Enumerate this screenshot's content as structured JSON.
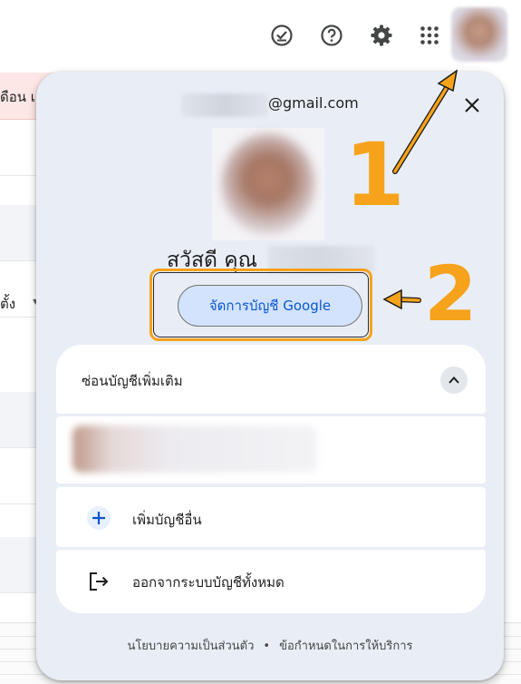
{
  "background": {
    "alert_text": "ดือน เ",
    "row_text": "ตั้ง"
  },
  "toolbar": {
    "icons": [
      "tasks-check-icon",
      "help-icon",
      "settings-gear-icon",
      "apps-grid-icon"
    ]
  },
  "panel": {
    "email": "@gmail.com",
    "greeting": "สวัสดี คุณ",
    "manage_button": "จัดการบัญชี Google",
    "hide_accounts_label": "ซ่อนบัญชีเพิ่มเติม",
    "add_account_label": "เพิ่มบัญชีอื่น",
    "sign_out_label": "ออกจากระบบบัญชีทั้งหมด",
    "footer": {
      "privacy": "นโยบายความเป็นส่วนตัว",
      "separator": "•",
      "terms": "ข้อกำหนดในการให้บริการ"
    }
  },
  "annotations": {
    "step1": "1",
    "step2": "2",
    "color": "#f6a21a"
  }
}
